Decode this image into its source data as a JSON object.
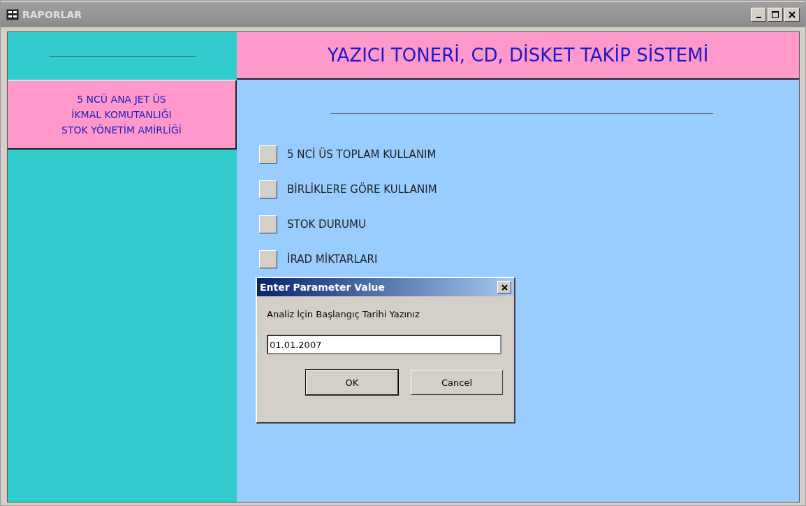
{
  "window": {
    "title": "RAPORLAR"
  },
  "header": {
    "title": "YAZICI TONERİ, CD, DİSKET TAKİP SİSTEMİ"
  },
  "unit_lines": [
    "5 NCÜ ANA JET ÜS",
    "İKMAL KOMUTANLIĞI",
    "STOK YÖNETİM AMİRLİĞİ"
  ],
  "menu": [
    {
      "label": "5 NCİ ÜS TOPLAM KULLANIM"
    },
    {
      "label": "BİRLİKLERE GÖRE KULLANIM"
    },
    {
      "label": "STOK DURUMU"
    },
    {
      "label": "İRAD MİKTARLARI"
    }
  ],
  "dialog": {
    "title": "Enter Parameter Value",
    "prompt": "Analiz İçin Başlangıç Tarihi Yazınız",
    "value": "01.01.2007",
    "buttons": [
      "OK",
      "Cancel"
    ]
  }
}
